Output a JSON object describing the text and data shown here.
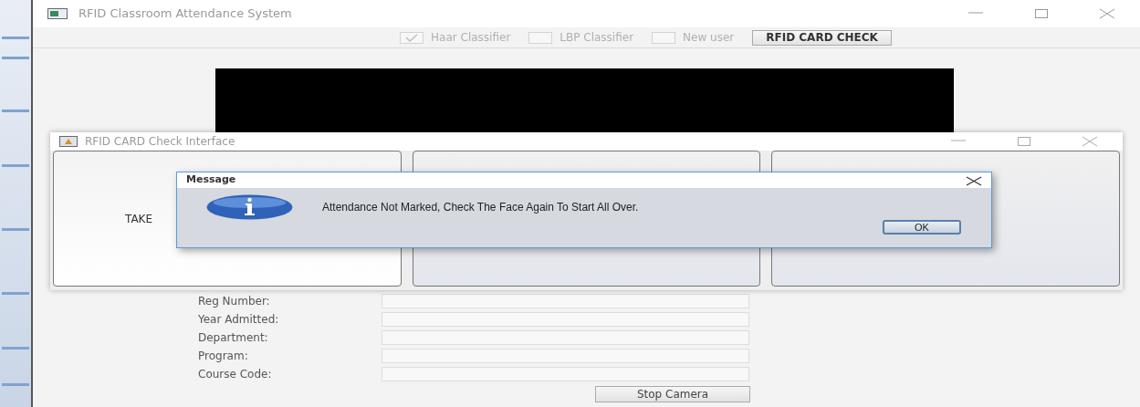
{
  "main_window": {
    "title": "RFID Classroom Attendance System",
    "options": [
      {
        "label": "Haar Classifier",
        "checked": true,
        "disabled": true
      },
      {
        "label": "LBP Classifier",
        "checked": false,
        "disabled": true
      },
      {
        "label": "New user",
        "checked": false,
        "disabled": true
      }
    ],
    "check_button": "RFID CARD CHECK",
    "form": [
      {
        "label": "Reg Number:"
      },
      {
        "label": "Year Admitted:"
      },
      {
        "label": "Department:"
      },
      {
        "label": "Program:"
      },
      {
        "label": "Course Code:"
      }
    ],
    "stop_button": "Stop Camera"
  },
  "check_window": {
    "title": "RFID CARD Check Interface",
    "first_panel_text": "TAKE"
  },
  "message_dialog": {
    "title": "Message",
    "text": "Attendance Not Marked, Check The Face Again To Start All Over.",
    "button": "OK"
  }
}
